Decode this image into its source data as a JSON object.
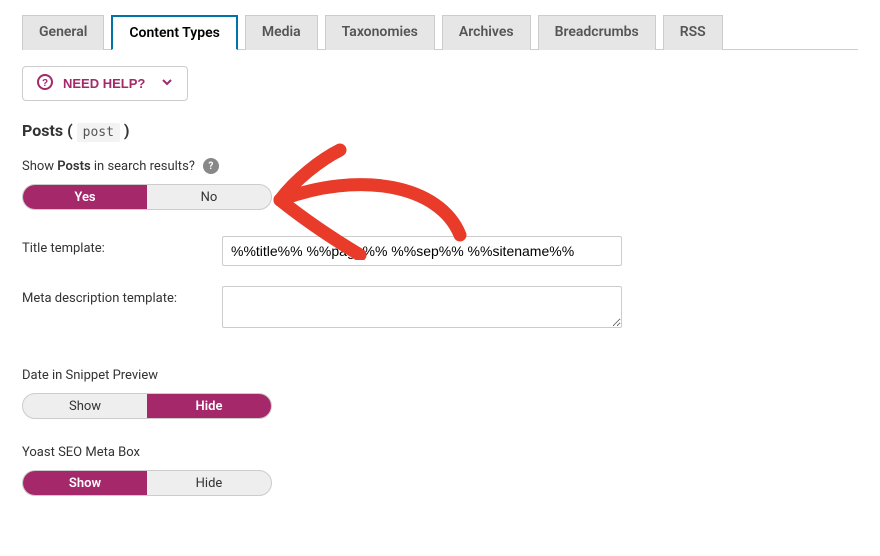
{
  "tabs": [
    {
      "label": "General"
    },
    {
      "label": "Content Types"
    },
    {
      "label": "Media"
    },
    {
      "label": "Taxonomies"
    },
    {
      "label": "Archives"
    },
    {
      "label": "Breadcrumbs"
    },
    {
      "label": "RSS"
    }
  ],
  "need_help": {
    "label": "NEED HELP?"
  },
  "posts_section": {
    "heading_prefix": "Posts ( ",
    "heading_code": "post",
    "heading_suffix": " )"
  },
  "search_results": {
    "pre": "Show ",
    "bold": "Posts",
    "post": " in search results?",
    "toggle_yes": "Yes",
    "toggle_no": "No",
    "selected": "Yes"
  },
  "title_template": {
    "label": "Title template:",
    "value": "%%title%% %%page%% %%sep%% %%sitename%%"
  },
  "meta_description": {
    "label": "Meta description template:",
    "value": ""
  },
  "date_snippet": {
    "label": "Date in Snippet Preview",
    "toggle_show": "Show",
    "toggle_hide": "Hide",
    "selected": "Hide"
  },
  "meta_box": {
    "label": "Yoast SEO Meta Box",
    "toggle_show": "Show",
    "toggle_hide": "Hide",
    "selected": "Show"
  }
}
